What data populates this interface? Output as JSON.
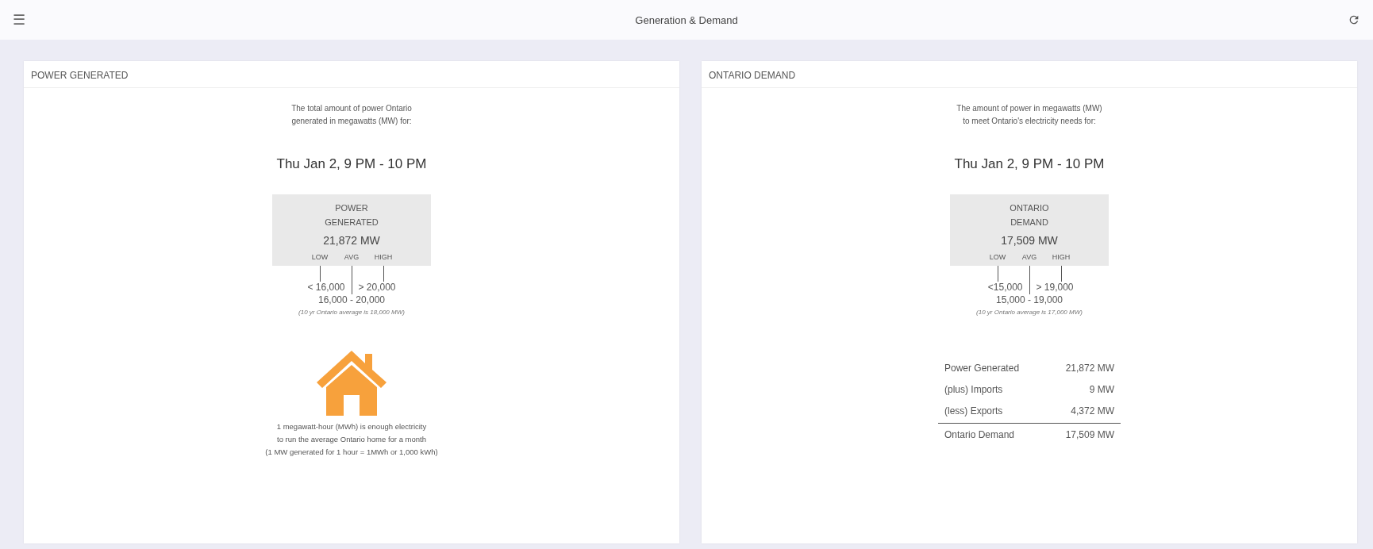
{
  "app_bar": {
    "menu_icon": "☰",
    "title": "Generation & Demand"
  },
  "panels": [
    {
      "title": "POWER GENERATED",
      "description": [
        "The total amount of power Ontario",
        "generated in megawatts (MW) for:"
      ],
      "date": "Thu Jan 2, 9 PM - 10 PM",
      "gauge": {
        "label_lines": [
          "POWER",
          "GENERATED"
        ],
        "value": "21,872 MW",
        "levels": [
          "LOW",
          "AVG",
          "HIGH"
        ],
        "low_range": "< 16,000",
        "high_range": "> 20,000",
        "avg_range": "16,000 - 20,000",
        "note": "(10 yr Ontario average is 18,000 MW)"
      },
      "info": {
        "lines": [
          "1 megawatt-hour (MWh) is enough electricity",
          "to run the average Ontario home for a month",
          "(1 MW generated for 1 hour = 1MWh or 1,000 kWh)"
        ]
      }
    },
    {
      "title": "ONTARIO DEMAND",
      "description": [
        "The amount of power in megawatts (MW)",
        "to meet Ontario's electricity needs for:"
      ],
      "date": "Thu Jan 2, 9 PM - 10 PM",
      "gauge": {
        "label_lines": [
          "ONTARIO",
          "DEMAND"
        ],
        "value": "17,509 MW",
        "levels": [
          "LOW",
          "AVG",
          "HIGH"
        ],
        "low_range": "<15,000",
        "high_range": "> 19,000",
        "avg_range": "15,000 - 19,000",
        "note": "(10 yr Ontario average is 17,000 MW)"
      },
      "balance": {
        "rows": [
          {
            "label": "Power Generated",
            "value": "21,872 MW"
          },
          {
            "label": "(plus) Imports",
            "value": "9 MW"
          },
          {
            "label": "(less) Exports",
            "value": "4,372 MW"
          }
        ],
        "total": {
          "label": "Ontario Demand",
          "value": "17,509 MW"
        }
      }
    }
  ]
}
